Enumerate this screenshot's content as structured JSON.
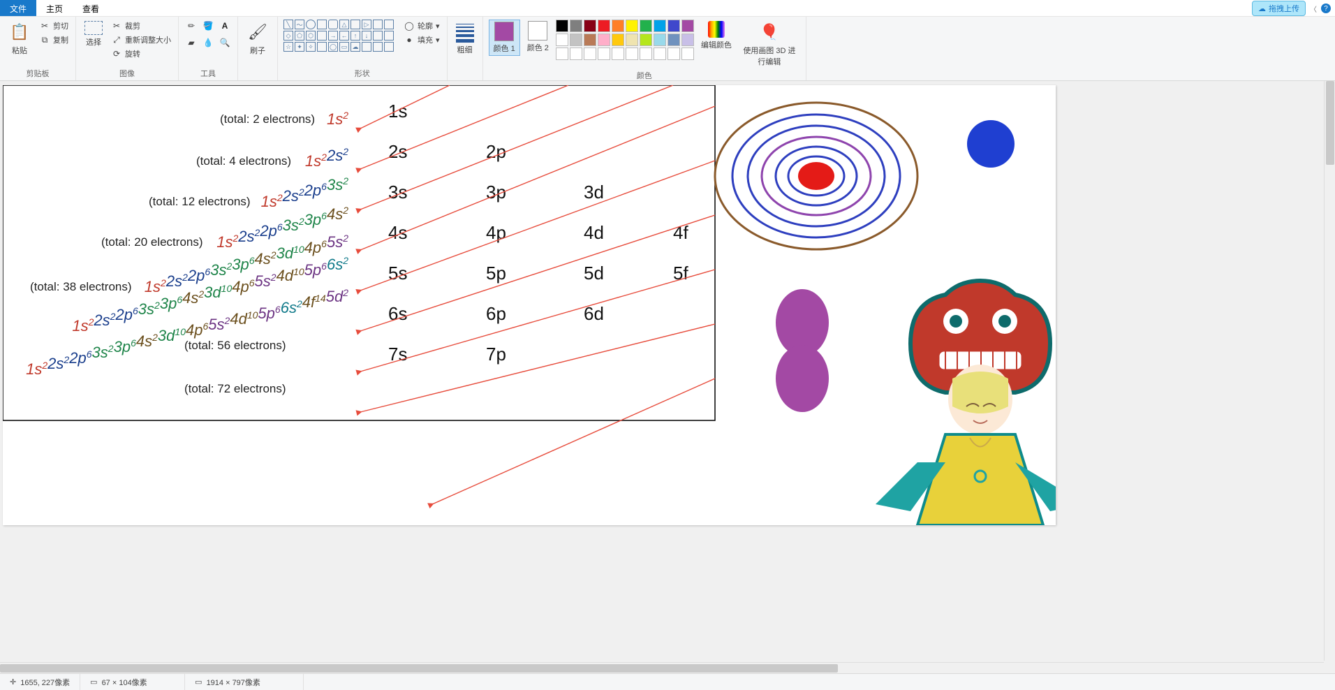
{
  "menu": {
    "file": "文件",
    "home": "主页",
    "view": "查看",
    "upload": "拖拽上传"
  },
  "ribbon": {
    "clipboard": {
      "label": "剪贴板",
      "paste": "粘贴",
      "cut": "剪切",
      "copy": "复制"
    },
    "image": {
      "label": "图像",
      "select": "选择",
      "crop": "裁剪",
      "resize": "重新调整大小",
      "rotate": "旋转"
    },
    "tools": {
      "label": "工具"
    },
    "brush": {
      "label": "刷子"
    },
    "shapes": {
      "label": "形状",
      "outline": "轮廓",
      "fill": "填充"
    },
    "stroke": {
      "label": "粗细"
    },
    "colors": {
      "label": "颜色",
      "color1": "颜色 1",
      "color2": "颜色 2",
      "edit": "编辑颜色"
    },
    "paint3d": {
      "label": "使用画图 3D 进行编辑"
    }
  },
  "palette": [
    "#000000",
    "#7f7f7f",
    "#880015",
    "#ed1c24",
    "#ff7f27",
    "#fff200",
    "#22b14c",
    "#00a2e8",
    "#3f48cc",
    "#a349a4",
    "#ffffff",
    "#c3c3c3",
    "#b97a57",
    "#ffaec9",
    "#ffc90e",
    "#efe4b0",
    "#b5e61d",
    "#99d9ea",
    "#7092be",
    "#c8bfe7"
  ],
  "current_color1": "#a349a4",
  "current_color2": "#ffffff",
  "status": {
    "pos": "1655, 227像素",
    "sel": "67 × 104像素",
    "size": "1914 × 797像素"
  },
  "orbitals": {
    "columns": [
      [
        "1s",
        "2s",
        "3s",
        "4s",
        "5s",
        "6s",
        "7s"
      ],
      [
        "",
        "2p",
        "3p",
        "4p",
        "5p",
        "6p",
        "7p"
      ],
      [
        "",
        "",
        "3d",
        "4d",
        "5d",
        "6d",
        ""
      ],
      [
        "",
        "",
        "",
        "4f",
        "5f",
        "",
        ""
      ]
    ],
    "rows": [
      {
        "total": "(total: 2 electrons)",
        "config": [
          [
            "1s",
            "2"
          ]
        ]
      },
      {
        "total": "(total: 4 electrons)",
        "config": [
          [
            "1s",
            "2"
          ],
          [
            "2s",
            "2"
          ]
        ]
      },
      {
        "total": "(total: 12 electrons)",
        "config": [
          [
            "1s",
            "2"
          ],
          [
            "2s",
            "2"
          ],
          [
            "2p",
            "6"
          ],
          [
            "3s",
            "2"
          ]
        ]
      },
      {
        "total": "(total: 20 electrons)",
        "config": [
          [
            "1s",
            "2"
          ],
          [
            "2s",
            "2"
          ],
          [
            "2p",
            "6"
          ],
          [
            "3s",
            "2"
          ],
          [
            "3p",
            "6"
          ],
          [
            "4s",
            "2"
          ]
        ]
      },
      {
        "total": "(total: 38 electrons)",
        "config": [
          [
            "1s",
            "2"
          ],
          [
            "2s",
            "2"
          ],
          [
            "2p",
            "6"
          ],
          [
            "3s",
            "2"
          ],
          [
            "3p",
            "6"
          ],
          [
            "4s",
            "2"
          ],
          [
            "3d",
            "10"
          ],
          [
            "4p",
            "6"
          ],
          [
            "5s",
            "2"
          ]
        ]
      },
      {
        "total": "(total: 56 electrons)",
        "config": [
          [
            "1s",
            "2"
          ],
          [
            "2s",
            "2"
          ],
          [
            "2p",
            "6"
          ],
          [
            "3s",
            "2"
          ],
          [
            "3p",
            "6"
          ],
          [
            "4s",
            "2"
          ],
          [
            "3d",
            "10"
          ],
          [
            "4p",
            "6"
          ],
          [
            "5s",
            "2"
          ],
          [
            "4d",
            "10"
          ],
          [
            "5p",
            "6"
          ],
          [
            "6s",
            "2"
          ]
        ]
      },
      {
        "total": "(total: 72 electrons)",
        "config": [
          [
            "1s",
            "2"
          ],
          [
            "2s",
            "2"
          ],
          [
            "2p",
            "6"
          ],
          [
            "3s",
            "2"
          ],
          [
            "3p",
            "6"
          ],
          [
            "4s",
            "2"
          ],
          [
            "3d",
            "10"
          ],
          [
            "4p",
            "6"
          ],
          [
            "5s",
            "2"
          ],
          [
            "4d",
            "10"
          ],
          [
            "5p",
            "6"
          ],
          [
            "6s",
            "2"
          ],
          [
            "4f",
            "14"
          ],
          [
            "5d",
            "2"
          ]
        ]
      }
    ],
    "config_colors": {
      "1": "#c0392b",
      "2": "#1a3e8c",
      "3": "#1e8449",
      "4": "#6b4f1d",
      "5": "#6c3483",
      "6": "#117a8a",
      "7": "#444444"
    }
  }
}
